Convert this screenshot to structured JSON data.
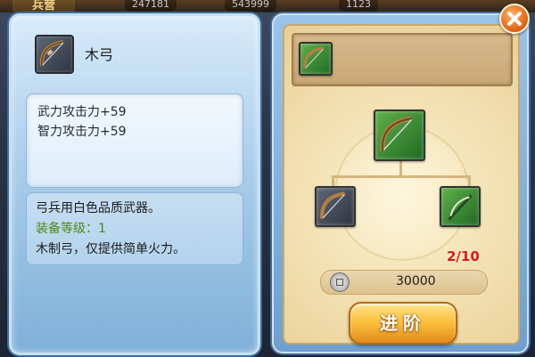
{
  "background": {
    "tab_label": "兵营",
    "stat_1": "247181",
    "stat_2": "543999",
    "stat_3": "1123"
  },
  "item": {
    "name": "木弓",
    "icon": "bow-icon",
    "stats": [
      "武力攻击力+59",
      "智力攻击力+59"
    ],
    "description": {
      "line_1": "弓兵用白色品质武器。",
      "equip_level": "装备等级：1",
      "line_3": "木制弓，仅提供简单火力。"
    }
  },
  "upgrade": {
    "material_count": "2/10",
    "cost": "30000",
    "button_label": "进阶",
    "cost_icon": "silver-coin-icon"
  },
  "colors": {
    "accent_red": "#d21d1d",
    "equip_level_green": "#4d8a12",
    "button_orange": "#fbbf3a"
  }
}
